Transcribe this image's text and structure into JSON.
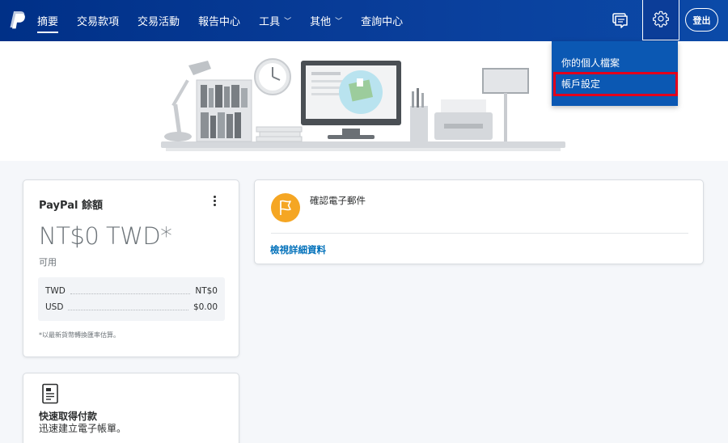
{
  "header": {
    "nav": [
      {
        "label": "摘要",
        "active": true,
        "dropdown": false
      },
      {
        "label": "交易款項",
        "active": false,
        "dropdown": false
      },
      {
        "label": "交易活動",
        "active": false,
        "dropdown": false
      },
      {
        "label": "報告中心",
        "active": false,
        "dropdown": false
      },
      {
        "label": "工具",
        "active": false,
        "dropdown": true
      },
      {
        "label": "其他",
        "active": false,
        "dropdown": true
      },
      {
        "label": "查詢中心",
        "active": false,
        "dropdown": false
      }
    ],
    "logout_label": "登出",
    "icons": {
      "logo": "paypal-logo",
      "messages": "message-icon",
      "settings": "gear-icon"
    }
  },
  "settings_menu": {
    "items": [
      "你的個人檔案",
      "帳戶設定"
    ],
    "highlighted_index": 1
  },
  "balance_card": {
    "title": "PayPal 餘額",
    "amount": "NT$0 TWD*",
    "available_label": "可用",
    "rows": [
      {
        "currency": "TWD",
        "amount": "NT$0"
      },
      {
        "currency": "USD",
        "amount": "$0.00"
      }
    ],
    "footnote": "*以最新貨幣轉換匯率估算。"
  },
  "invoice_card": {
    "title": "快速取得付款",
    "subtitle": "迅速建立電子帳單。"
  },
  "confirm_card": {
    "text": "確認電子郵件",
    "link": "檢視詳細資料"
  },
  "colors": {
    "header_bg": "#003087",
    "dropdown_bg": "#0b58b3",
    "highlight_border": "#e3001b",
    "link": "#0070ba",
    "flag_circle": "#f5a623"
  }
}
